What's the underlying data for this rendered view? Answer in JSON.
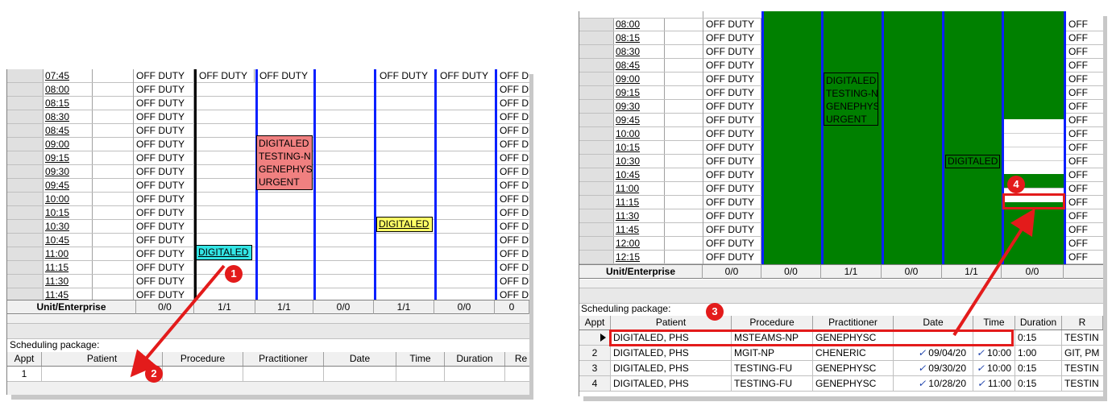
{
  "left": {
    "times": [
      "07:45",
      "08:00",
      "08:15",
      "08:30",
      "08:45",
      "09:00",
      "09:15",
      "09:30",
      "09:45",
      "10:00",
      "10:15",
      "10:30",
      "10:45",
      "11:00",
      "11:15",
      "11:30",
      "11:45"
    ],
    "off_duty": "OFF DUTY",
    "off_duty_trunc": "OFF DU",
    "appointments": {
      "cyan": "DIGITALED",
      "pink": [
        "DIGITALED",
        "TESTING-N",
        "GENEPHYS",
        "URGENT"
      ],
      "yellow": "DIGITALED"
    },
    "summary": {
      "label": "Unit/Enterprise",
      "values": [
        "0/0",
        "1/1",
        "1/1",
        "0/0",
        "1/1",
        "0/0",
        "0"
      ]
    },
    "package_label": "Scheduling package:",
    "columns": [
      "Appt",
      "Patient",
      "Procedure",
      "Practitioner",
      "Date",
      "Time",
      "Duration",
      "Re"
    ],
    "rows": [
      {
        "appt": "1"
      }
    ]
  },
  "right": {
    "times": [
      "08:00",
      "08:15",
      "08:30",
      "08:45",
      "09:00",
      "09:15",
      "09:30",
      "09:45",
      "10:00",
      "10:15",
      "10:30",
      "10:45",
      "11:00",
      "11:15",
      "11:30",
      "11:45",
      "12:00",
      "12:15"
    ],
    "off_duty": "OFF DUTY",
    "off_trunc": "OFF",
    "appointments": {
      "block": [
        "DIGITALED",
        "TESTING-N",
        "GENEPHYS",
        "URGENT"
      ],
      "small": "DIGITALED"
    },
    "summary": {
      "label": "Unit/Enterprise",
      "values": [
        "0/0",
        "0/0",
        "1/1",
        "0/0",
        "1/1",
        "0/0"
      ]
    },
    "package_label": "Scheduling package:",
    "columns": [
      "Appt",
      "Patient",
      "Procedure",
      "Practitioner",
      "Date",
      "Time",
      "Duration",
      "R"
    ],
    "rows": [
      {
        "appt": "",
        "patient": "DIGITALED, PHS",
        "procedure": "MSTEAMS-NP",
        "practitioner": "GENEPHYSC",
        "date": "",
        "time": "",
        "duration": "0:15",
        "extra": "TESTIN"
      },
      {
        "appt": "2",
        "patient": "DIGITALED, PHS",
        "procedure": "MGIT-NP",
        "practitioner": "CHENERIC",
        "date": "09/04/20",
        "time": "10:00",
        "duration": "1:00",
        "extra": "GIT, PM"
      },
      {
        "appt": "3",
        "patient": "DIGITALED, PHS",
        "procedure": "TESTING-FU",
        "practitioner": "GENEPHYSC",
        "date": "09/30/20",
        "time": "10:00",
        "duration": "0:15",
        "extra": "TESTIN"
      },
      {
        "appt": "4",
        "patient": "DIGITALED, PHS",
        "procedure": "TESTING-FU",
        "practitioner": "GENEPHYSC",
        "date": "10/28/20",
        "time": "11:00",
        "duration": "0:15",
        "extra": "TESTIN"
      }
    ]
  },
  "callouts": [
    "1",
    "2",
    "3",
    "4"
  ],
  "colors": {
    "accent_red": "#e31b1b",
    "scheduled_green": "#008000",
    "column_blue": "#0a20ff",
    "cyan": "#33e5e5",
    "pink": "#f08080",
    "yellow": "#ffff66"
  }
}
